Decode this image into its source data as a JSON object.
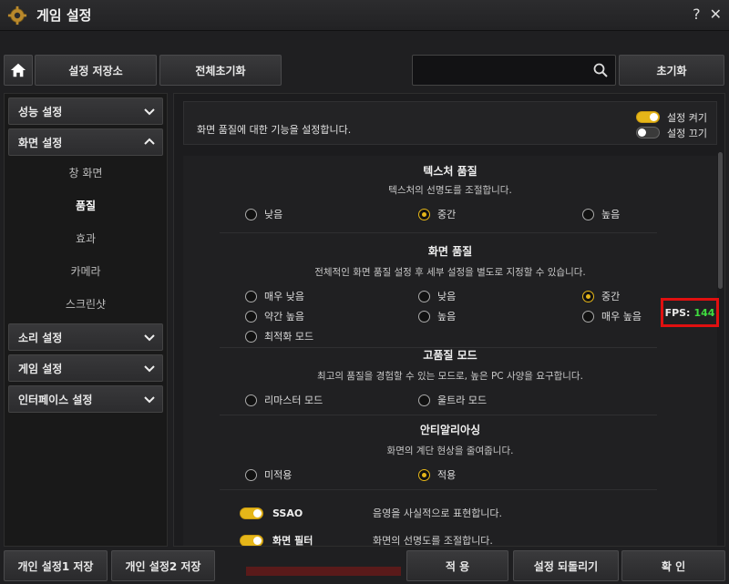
{
  "window": {
    "title": "게임 설정",
    "help": "?",
    "close": "✕"
  },
  "toolbar": {
    "save_slot": "설정 저장소",
    "reset_all": "전체초기화",
    "search_placeholder": "",
    "init": "초기화"
  },
  "sidebar": {
    "categories": [
      {
        "label": "성능 설정"
      },
      {
        "label": "화면 설정"
      },
      {
        "label": "소리 설정"
      },
      {
        "label": "게임 설정"
      },
      {
        "label": "인터페이스 설정"
      }
    ],
    "sub_items": [
      {
        "label": "창 화면"
      },
      {
        "label": "품질"
      },
      {
        "label": "효과"
      },
      {
        "label": "카메라"
      },
      {
        "label": "스크린샷"
      }
    ]
  },
  "main": {
    "description": "화면 품질에 대한 기능을 설정합니다.",
    "legend_on": "설정 켜기",
    "legend_off": "설정 끄기",
    "texture": {
      "title": "텍스처 품질",
      "desc": "텍스처의 선명도를 조절합니다.",
      "options": [
        "낮음",
        "중간",
        "높음"
      ],
      "selected": 1
    },
    "screen": {
      "title": "화면 품질",
      "desc": "전체적인 화면 품질 설정 후 세부 설정을 별도로 지정할 수 있습니다.",
      "options": [
        "매우 낮음",
        "낮음",
        "중간",
        "약간 높음",
        "높음",
        "매우 높음",
        "최적화 모드"
      ],
      "selected": 2
    },
    "hq": {
      "title": "고품질 모드",
      "desc": "최고의 품질을 경험할 수 있는 모드로, 높은 PC 사양을 요구합니다.",
      "options": [
        "리마스터 모드",
        "울트라 모드"
      ]
    },
    "aa": {
      "title": "안티알리아싱",
      "desc": "화면의 계단 현상을 줄여줍니다.",
      "options": [
        "미적용",
        "적용"
      ],
      "selected": 1
    },
    "features": [
      {
        "name": "SSAO",
        "desc": "음영을 사실적으로 표현합니다."
      },
      {
        "name": "화면 필터",
        "desc": "화면의 선명도를 조절합니다."
      }
    ],
    "fps": {
      "label": "FPS:",
      "value": "144"
    }
  },
  "bottom": {
    "slot1": "개인 설정1 저장",
    "slot2": "개인 설정2 저장",
    "apply": "적 용",
    "revert": "설정 되돌리기",
    "ok": "확 인"
  },
  "colors": {
    "accent": "#e5b619",
    "fps_value": "#3fdc3f",
    "highlight_border": "#e01010"
  }
}
